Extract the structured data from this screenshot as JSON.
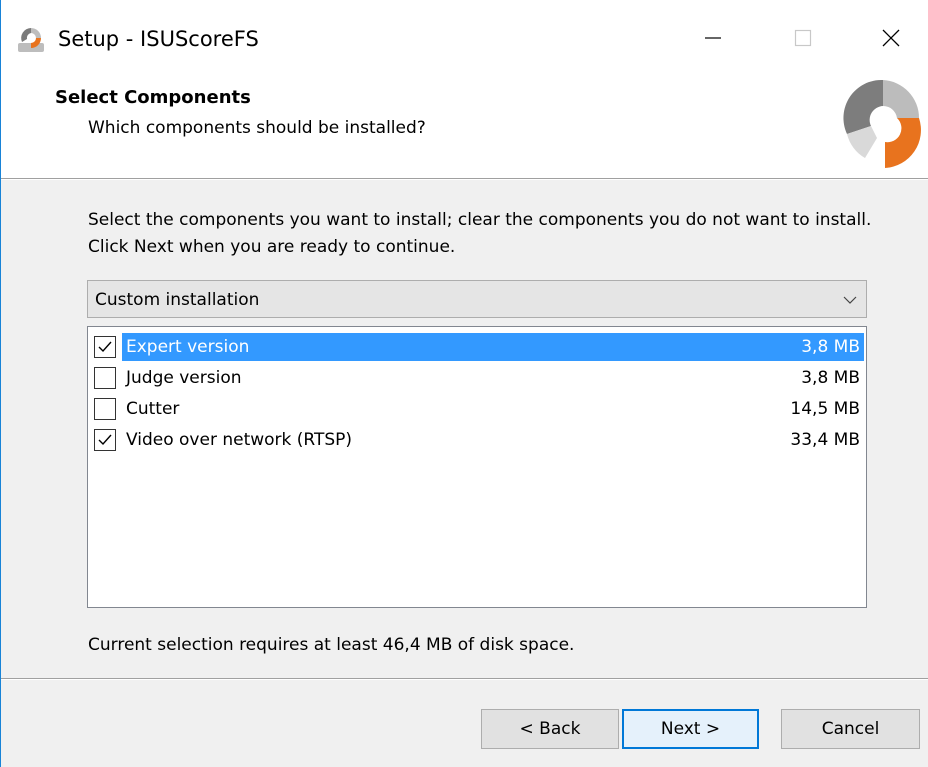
{
  "window": {
    "title": "Setup - ISUScoreFS",
    "icon": "setup-app-icon",
    "controls": [
      "minimize-icon",
      "maximize-icon",
      "close-icon"
    ]
  },
  "header": {
    "title": "Select Components",
    "subtitle": "Which components should be installed?",
    "logo": "isuscore-logo"
  },
  "content": {
    "instructions": "Select the components you want to install; clear the components you do not want to install. Click Next when you are ready to continue.",
    "installation_type": {
      "selected": "Custom installation"
    },
    "components": [
      {
        "label": "Expert version",
        "size": "3,8 MB",
        "checked": true,
        "selected": true
      },
      {
        "label": "Judge version",
        "size": "3,8 MB",
        "checked": false,
        "selected": false
      },
      {
        "label": "Cutter",
        "size": "14,5 MB",
        "checked": false,
        "selected": false
      },
      {
        "label": "Video over network (RTSP)",
        "size": "33,4 MB",
        "checked": true,
        "selected": false
      }
    ],
    "requirement": "Current selection requires at least 46,4 MB of disk space."
  },
  "buttons": {
    "back": "< Back",
    "next": "Next >",
    "cancel": "Cancel"
  },
  "colors": {
    "selection": "#3399ff",
    "accent": "#0078d7",
    "logo_orange": "#e8731e",
    "logo_gray": "#8a8a8a"
  }
}
